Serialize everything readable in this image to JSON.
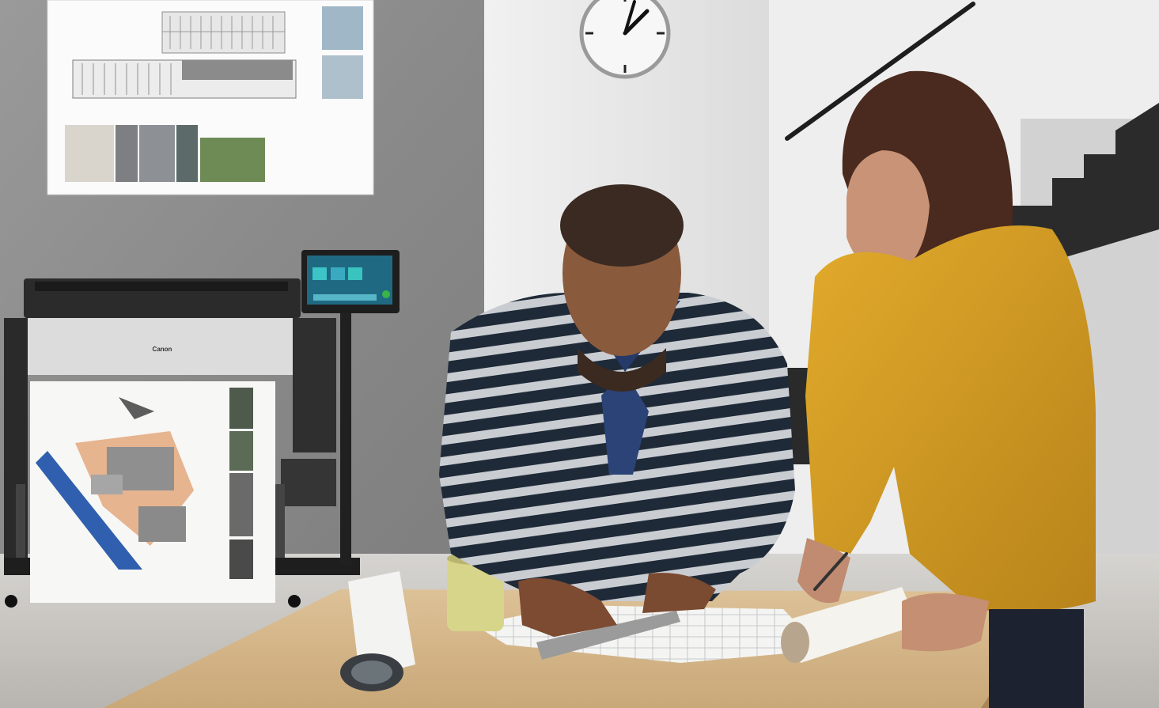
{
  "photo": {
    "printer": {
      "brand": "Canon"
    },
    "wall_poster": {},
    "touch_screen": {},
    "wall_clock": {},
    "people": [
      "man-striped-cardigan",
      "woman-yellow-sweater"
    ]
  },
  "palette": {
    "concrete_wall": "#8d8d8d",
    "white_wall": "#e9e9e9",
    "floor": "#c9c6c1",
    "desk": "#d7b98b",
    "sweater_yellow": "#d49a1f",
    "cardigan_dark": "#24303f"
  }
}
